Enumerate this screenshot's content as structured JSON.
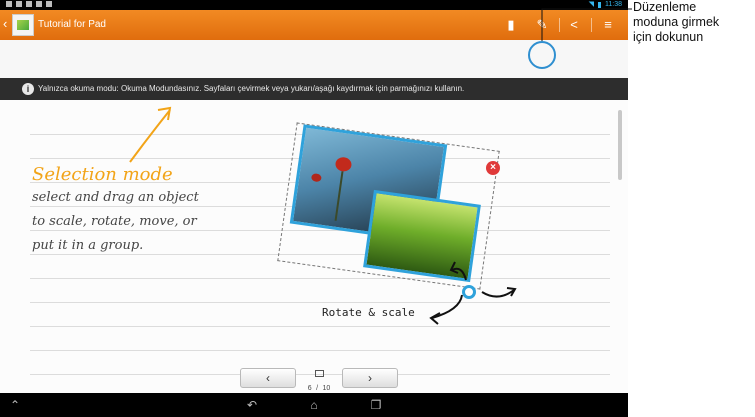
{
  "status_bar": {
    "time": "11:38"
  },
  "action_bar": {
    "back_glyph": "‹",
    "title": "Tutorial for Pad",
    "actions": [
      {
        "name": "bookmark-icon",
        "glyph": "▮"
      },
      {
        "name": "edit-mode-icon",
        "glyph": "✎"
      },
      {
        "name": "share-icon",
        "glyph": "<"
      },
      {
        "name": "menu-icon",
        "glyph": "≡"
      }
    ]
  },
  "info_banner": {
    "icon": "i",
    "text": "Yalnızca okuma modu: Okuma Modundasınız. Sayfaları çevirmek veya yukarı/aşağı kaydırmak için parmağınızı kullanın."
  },
  "notebook": {
    "title": "Selection mode",
    "lines": [
      "select and drag an object",
      "to scale, rotate, move, or",
      "put it in a group."
    ],
    "rotate_label": "Rotate & scale",
    "close_glyph": "×"
  },
  "pager": {
    "prev_glyph": "‹",
    "next_glyph": "›",
    "current_page": "6",
    "separator": "/",
    "total_pages": "10"
  },
  "nav_bar": {
    "buttons": [
      {
        "name": "collapse-icon",
        "glyph": "⌃"
      },
      {
        "name": "back-icon",
        "glyph": "↶"
      },
      {
        "name": "home-icon",
        "glyph": "⌂"
      },
      {
        "name": "recents-icon",
        "glyph": "❐"
      }
    ]
  },
  "callout": {
    "lines": [
      "Düzenleme",
      "moduna girmek",
      "için dokunun"
    ]
  },
  "colors": {
    "action_bar": "#e97a16",
    "accent_blue": "#2fa2db",
    "handwriting_orange": "#f2a418",
    "banner": "#2d2d2d"
  }
}
